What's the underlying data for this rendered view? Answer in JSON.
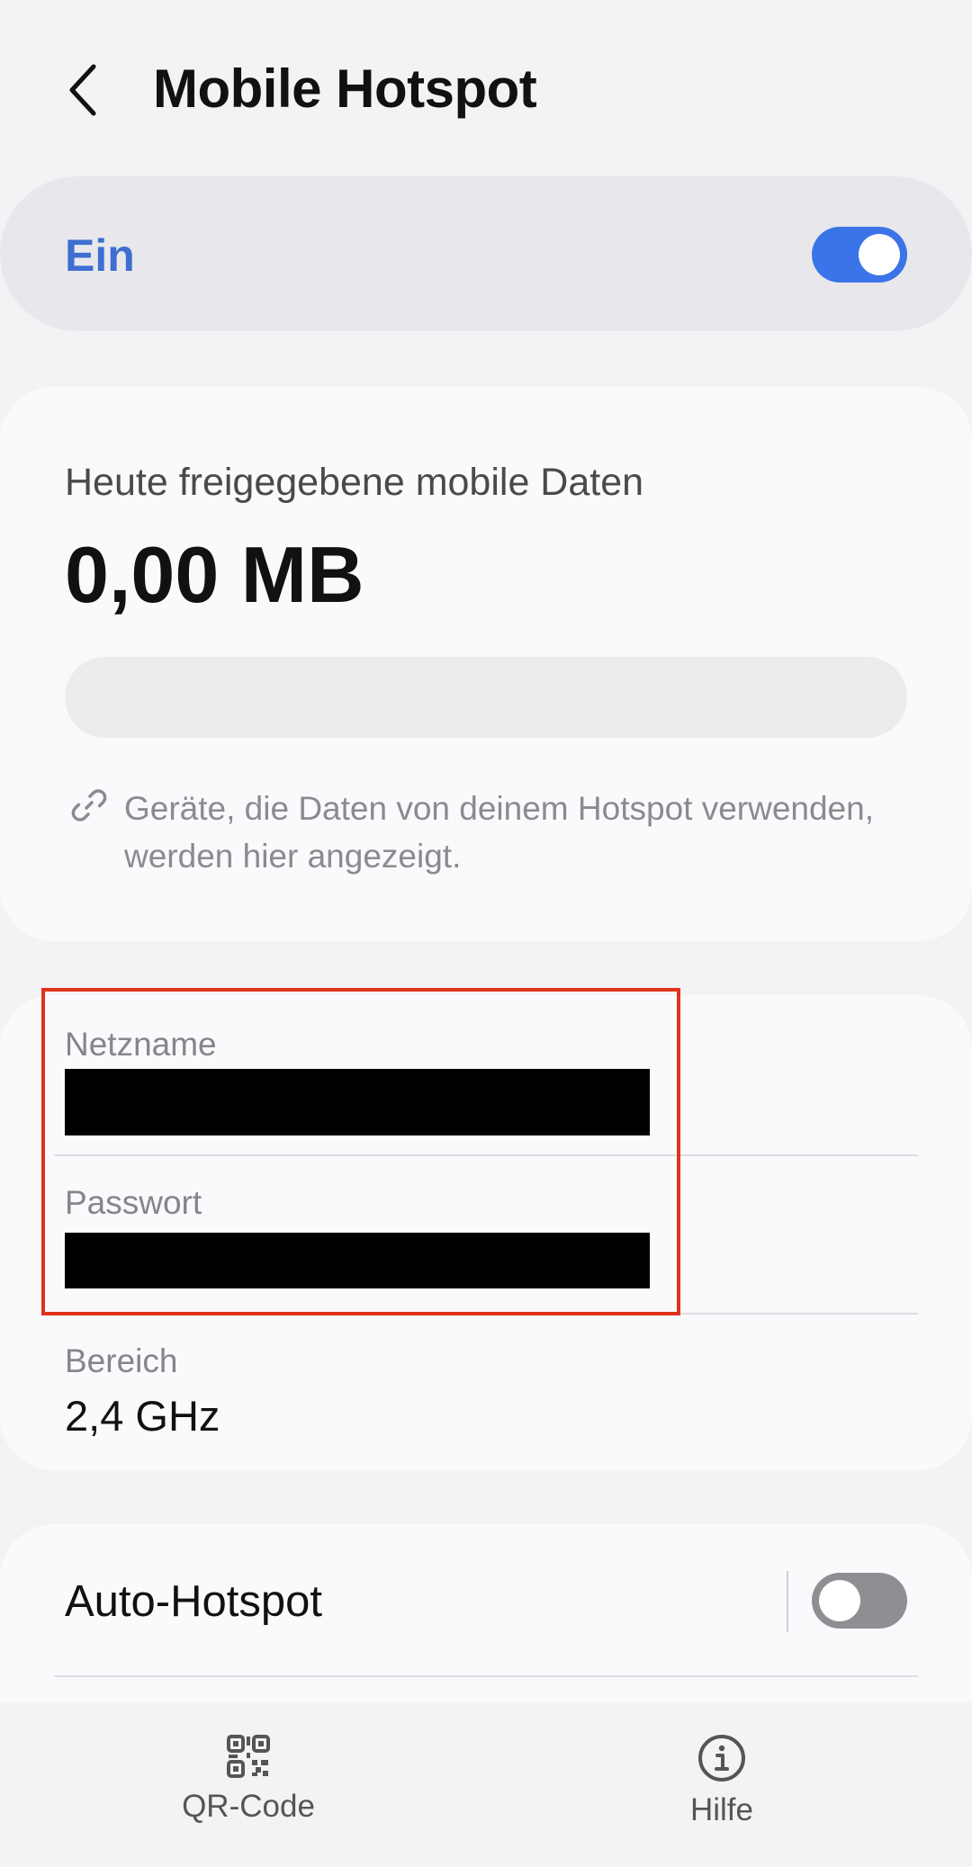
{
  "header": {
    "title": "Mobile Hotspot",
    "back_icon": "chevron-left-icon"
  },
  "master_switch": {
    "label": "Ein",
    "state": "on",
    "accent_color": "#3b74e8"
  },
  "usage": {
    "label": "Heute freigegebene mobile Daten",
    "value": "0,00 MB",
    "progress_fraction": 0,
    "info_icon": "link-icon",
    "info_text": "Geräte, die Daten von deinem Hotspot verwenden, werden hier angezeigt."
  },
  "network": {
    "name_label": "Netzname",
    "password_label": "Passwort",
    "band_label": "Bereich",
    "band_value": "2,4 GHz"
  },
  "auto_hotspot": {
    "label": "Auto-Hotspot",
    "state": "off"
  },
  "bottom_bar": {
    "qr_label": "QR-Code",
    "qr_icon": "qr-code-icon",
    "help_label": "Hilfe",
    "help_icon": "info-icon"
  }
}
